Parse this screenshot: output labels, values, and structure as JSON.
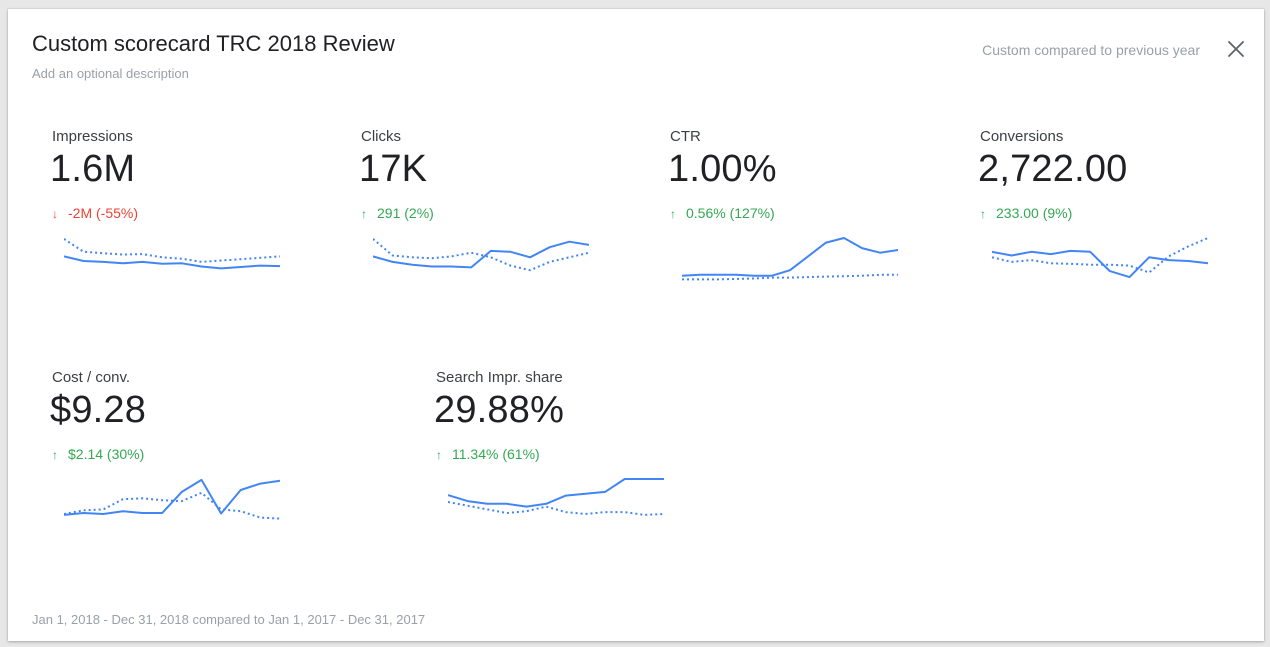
{
  "scorecard": {
    "title": "Custom scorecard TRC 2018 Review",
    "description_placeholder": "Add an optional description",
    "compare_label": "Custom compared to previous year",
    "date_range": "Jan 1, 2018 - Dec 31, 2018 compared to Jan 1, 2017 - Dec 31, 2017"
  },
  "colors": {
    "primary_line": "#4285f4",
    "positive": "#34a853",
    "negative": "#ea4335"
  },
  "icons": {
    "close": "close-icon",
    "up": "arrow-up-icon",
    "down": "arrow-down-icon"
  },
  "metrics": [
    {
      "label": "Impressions",
      "value": "1.6M",
      "change": "-2M (-55%)",
      "direction": "down",
      "current": [
        0.4,
        0.5,
        0.52,
        0.55,
        0.52,
        0.56,
        0.55,
        0.62,
        0.66,
        0.63,
        0.6,
        0.61
      ],
      "previous": [
        0.02,
        0.3,
        0.33,
        0.36,
        0.35,
        0.42,
        0.45,
        0.52,
        0.49,
        0.46,
        0.43,
        0.4
      ]
    },
    {
      "label": "Clicks",
      "value": "17K",
      "change": "291 (2%)",
      "direction": "up",
      "current": [
        0.4,
        0.52,
        0.58,
        0.62,
        0.62,
        0.64,
        0.28,
        0.3,
        0.42,
        0.2,
        0.08,
        0.15
      ],
      "previous": [
        0.02,
        0.38,
        0.42,
        0.44,
        0.4,
        0.32,
        0.42,
        0.6,
        0.7,
        0.52,
        0.42,
        0.32
      ]
    },
    {
      "label": "CTR",
      "value": "1.00%",
      "change": "0.56% (127%)",
      "direction": "up",
      "current": [
        0.82,
        0.8,
        0.8,
        0.8,
        0.82,
        0.82,
        0.7,
        0.4,
        0.1,
        0.0,
        0.22,
        0.32,
        0.26
      ],
      "previous": [
        0.9,
        0.9,
        0.9,
        0.89,
        0.88,
        0.86,
        0.86,
        0.85,
        0.84,
        0.83,
        0.82,
        0.8,
        0.8
      ]
    },
    {
      "label": "Conversions",
      "value": "2,722.00",
      "change": "233.00 (9%)",
      "direction": "up",
      "current": [
        0.3,
        0.38,
        0.3,
        0.35,
        0.28,
        0.3,
        0.72,
        0.85,
        0.42,
        0.48,
        0.5,
        0.55
      ],
      "previous": [
        0.42,
        0.52,
        0.48,
        0.55,
        0.56,
        0.58,
        0.58,
        0.6,
        0.75,
        0.4,
        0.18,
        0.0
      ]
    },
    {
      "label": "Cost / conv.",
      "value": "$9.28",
      "change": "$2.14 (30%)",
      "direction": "up",
      "current": [
        0.78,
        0.74,
        0.76,
        0.7,
        0.74,
        0.74,
        0.28,
        0.02,
        0.75,
        0.24,
        0.1,
        0.04
      ],
      "previous": [
        0.76,
        0.68,
        0.66,
        0.44,
        0.42,
        0.46,
        0.48,
        0.3,
        0.66,
        0.7,
        0.84,
        0.86
      ]
    },
    {
      "label": "Search Impr. share",
      "value": "29.88%",
      "change": "11.34% (61%)",
      "direction": "up",
      "current": [
        0.35,
        0.48,
        0.54,
        0.54,
        0.6,
        0.54,
        0.36,
        0.32,
        0.28,
        0.0,
        0.0,
        0.0
      ],
      "previous": [
        0.5,
        0.58,
        0.66,
        0.74,
        0.7,
        0.6,
        0.72,
        0.76,
        0.72,
        0.72,
        0.78,
        0.76
      ]
    }
  ]
}
